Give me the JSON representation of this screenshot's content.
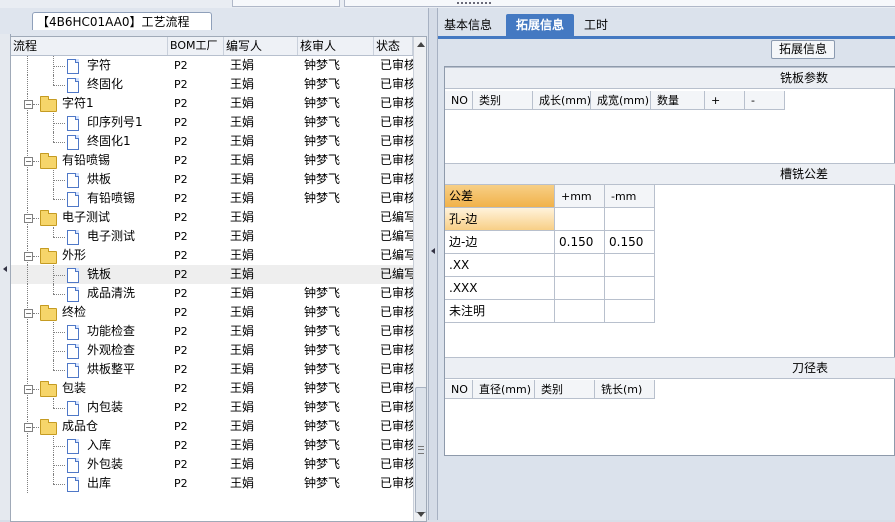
{
  "left_panel": {
    "tab_title": "【4B6HC01AA0】工艺流程",
    "columns": [
      "流程",
      "BOM工厂",
      "编写人",
      "核审人",
      "状态"
    ],
    "rows": [
      {
        "name": "字符",
        "level": 2,
        "type": "doc",
        "bom": "P2",
        "writer": "王娟",
        "reviewer": "钟梦飞",
        "status": "已审核"
      },
      {
        "name": "终固化",
        "level": 2,
        "type": "doc",
        "bom": "P2",
        "writer": "王娟",
        "reviewer": "钟梦飞",
        "status": "已审核"
      },
      {
        "name": "字符1",
        "level": 1,
        "type": "folder",
        "bom": "P2",
        "writer": "王娟",
        "reviewer": "钟梦飞",
        "status": "已审核"
      },
      {
        "name": "印序列号1",
        "level": 2,
        "type": "doc",
        "bom": "P2",
        "writer": "王娟",
        "reviewer": "钟梦飞",
        "status": "已审核"
      },
      {
        "name": "终固化1",
        "level": 2,
        "type": "doc",
        "bom": "P2",
        "writer": "王娟",
        "reviewer": "钟梦飞",
        "status": "已审核"
      },
      {
        "name": "有铅喷锡",
        "level": 1,
        "type": "folder",
        "bom": "P2",
        "writer": "王娟",
        "reviewer": "钟梦飞",
        "status": "已审核"
      },
      {
        "name": "烘板",
        "level": 2,
        "type": "doc",
        "bom": "P2",
        "writer": "王娟",
        "reviewer": "钟梦飞",
        "status": "已审核"
      },
      {
        "name": "有铅喷锡",
        "level": 2,
        "type": "doc",
        "bom": "P2",
        "writer": "王娟",
        "reviewer": "钟梦飞",
        "status": "已审核"
      },
      {
        "name": "电子测试",
        "level": 1,
        "type": "folder",
        "bom": "P2",
        "writer": "王娟",
        "reviewer": "",
        "status": "已编写"
      },
      {
        "name": "电子测试",
        "level": 2,
        "type": "doc",
        "bom": "P2",
        "writer": "王娟",
        "reviewer": "",
        "status": "已编写"
      },
      {
        "name": "外形",
        "level": 1,
        "type": "folder",
        "bom": "P2",
        "writer": "王娟",
        "reviewer": "",
        "status": "已编写"
      },
      {
        "name": "铣板",
        "level": 2,
        "type": "doc",
        "bom": "P2",
        "writer": "王娟",
        "reviewer": "",
        "status": "已编写",
        "selected": true
      },
      {
        "name": "成品清洗",
        "level": 2,
        "type": "doc",
        "bom": "P2",
        "writer": "王娟",
        "reviewer": "钟梦飞",
        "status": "已审核"
      },
      {
        "name": "终检",
        "level": 1,
        "type": "folder",
        "bom": "P2",
        "writer": "王娟",
        "reviewer": "钟梦飞",
        "status": "已审核"
      },
      {
        "name": "功能检查",
        "level": 2,
        "type": "doc",
        "bom": "P2",
        "writer": "王娟",
        "reviewer": "钟梦飞",
        "status": "已审核"
      },
      {
        "name": "外观检查",
        "level": 2,
        "type": "doc",
        "bom": "P2",
        "writer": "王娟",
        "reviewer": "钟梦飞",
        "status": "已审核"
      },
      {
        "name": "烘板整平",
        "level": 2,
        "type": "doc",
        "bom": "P2",
        "writer": "王娟",
        "reviewer": "钟梦飞",
        "status": "已审核"
      },
      {
        "name": "包装",
        "level": 1,
        "type": "folder",
        "bom": "P2",
        "writer": "王娟",
        "reviewer": "钟梦飞",
        "status": "已审核"
      },
      {
        "name": "内包装",
        "level": 2,
        "type": "doc",
        "bom": "P2",
        "writer": "王娟",
        "reviewer": "钟梦飞",
        "status": "已审核"
      },
      {
        "name": "成品仓",
        "level": 1,
        "type": "folder",
        "bom": "P2",
        "writer": "王娟",
        "reviewer": "钟梦飞",
        "status": "已审核"
      },
      {
        "name": "入库",
        "level": 2,
        "type": "doc",
        "bom": "P2",
        "writer": "王娟",
        "reviewer": "钟梦飞",
        "status": "已审核"
      },
      {
        "name": "外包装",
        "level": 2,
        "type": "doc",
        "bom": "P2",
        "writer": "王娟",
        "reviewer": "钟梦飞",
        "status": "已审核"
      },
      {
        "name": "出库",
        "level": 2,
        "type": "doc",
        "bom": "P2",
        "writer": "王娟",
        "reviewer": "钟梦飞",
        "status": "已审核"
      }
    ]
  },
  "right_panel": {
    "tabs": [
      "基本信息",
      "拓展信息",
      "工时"
    ],
    "active_tab": "拓展信息",
    "info_button": "拓展信息",
    "milling_params": {
      "title": "铣板参数",
      "columns": [
        "NO",
        "类别",
        "成长(mm)",
        "成宽(mm)",
        "数量",
        "+",
        "-"
      ]
    },
    "tolerance": {
      "title": "槽铣公差",
      "header": [
        "公差",
        "+mm",
        "-mm"
      ],
      "rows": [
        {
          "label": "孔-边",
          "plus": "",
          "minus": ""
        },
        {
          "label": "边-边",
          "plus": "0.150",
          "minus": "0.150"
        },
        {
          "label": ".XX",
          "plus": "",
          "minus": ""
        },
        {
          "label": ".XXX",
          "plus": "",
          "minus": ""
        },
        {
          "label": "未注明",
          "plus": "",
          "minus": ""
        }
      ]
    },
    "tool_table": {
      "title": "刀径表",
      "columns": [
        "NO",
        "直径(mm)",
        "类别",
        "铣长(m)"
      ]
    }
  }
}
